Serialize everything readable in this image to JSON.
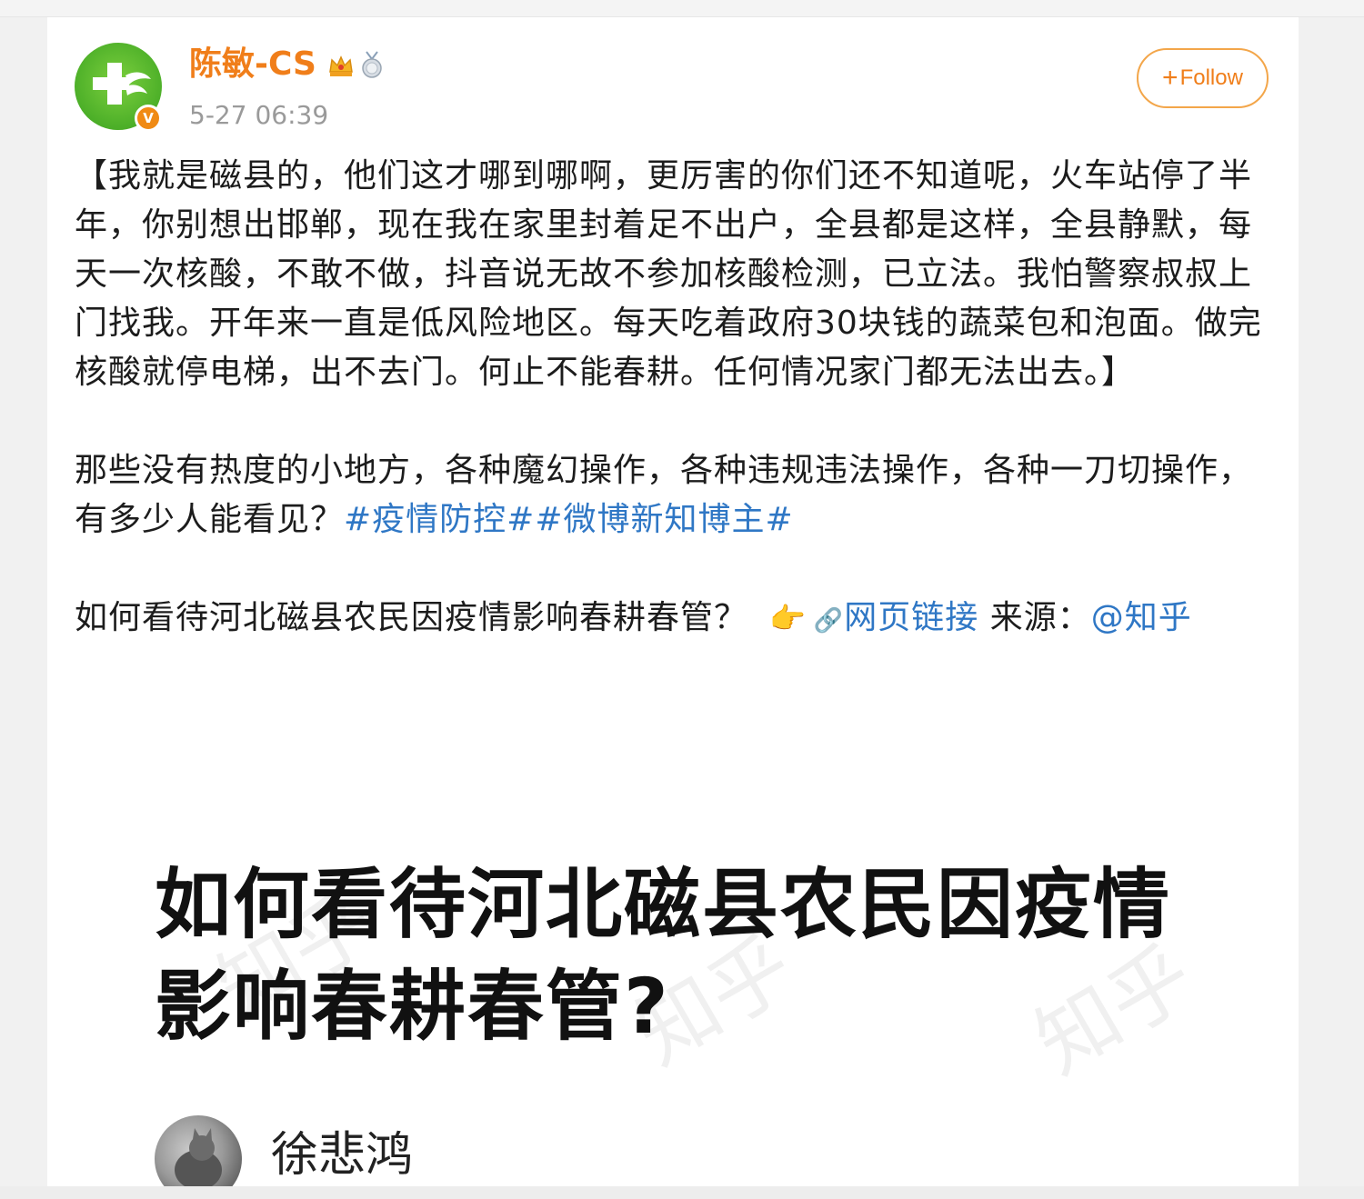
{
  "post": {
    "author_name": "陈敏-CS",
    "timestamp": "5-27 06:39",
    "verified_badge": "V",
    "follow_label": "Follow",
    "paragraph_1": "【我就是磁县的，他们这才哪到哪啊，更厉害的你们还不知道呢，火车站停了半年，你别想出邯郸，现在我在家里封着足不出户，全县都是这样，全县静默，每天一次核酸，不敢不做，抖音说无故不参加核酸检测，已立法。我怕警察叔叔上门找我。开年来一直是低风险地区。每天吃着政府30块钱的蔬菜包和泡面。做完核酸就停电梯，出不去门。何止不能春耕。任何情况家门都无法出去。】",
    "paragraph_2_text": "那些没有热度的小地方，各种魔幻操作，各种违规违法操作，各种一刀切操作，有多少人能看见？",
    "hashtag_1": "#疫情防控#",
    "hashtag_2": "#微博新知博主#",
    "paragraph_3_text": "如何看待河北磁县农民因疫情影响春耕春管？",
    "pointer_emoji": "👉",
    "link_icon": "🔗",
    "link_label": "网页链接",
    "source_label": " 来源：",
    "source_mention": "@知乎"
  },
  "preview": {
    "title": "如何看待河北磁县农民因疫情影响春耕春管?",
    "author_name": "徐悲鸿",
    "watermark": "知乎"
  },
  "colors": {
    "username": "#f07e1a",
    "link": "#2f77c5",
    "timestamp": "#9a9a9a",
    "follow_border": "#f3a64a"
  },
  "icons": {
    "avatar": "green-cross-logo",
    "crown": "crown-icon",
    "medal": "medal-icon",
    "verified": "verified-v-icon"
  }
}
